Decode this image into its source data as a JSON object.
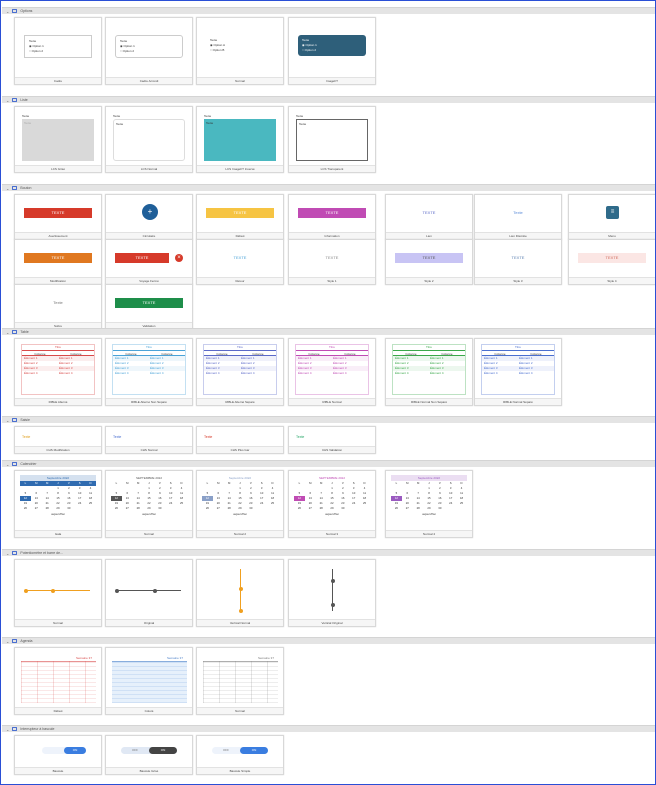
{
  "sections": [
    {
      "key": "radio",
      "title": "Options",
      "cards": [
        {
          "label": "Cadre",
          "title": "Texte",
          "options": [
            "Option 1",
            "Option 2"
          ]
        },
        {
          "label": "Cadre Arrondi",
          "title": "Texte",
          "options": [
            "Option 1",
            "Option 2"
          ]
        },
        {
          "label": "Normal",
          "title": "Texte",
          "options": [
            "Option A",
            "Option B"
          ]
        },
        {
          "label": "ImageFT",
          "title": "Texte",
          "options": [
            "Option 1",
            "Option 2"
          ]
        }
      ]
    },
    {
      "key": "list",
      "title": "Liste",
      "cards": [
        {
          "label": "LCS Grisé",
          "title": "Texte",
          "value": "Texte"
        },
        {
          "label": "LCS Normal",
          "title": "Texte",
          "value": "Texte"
        },
        {
          "label": "LCS ImageFT Inversé",
          "title": "Texte",
          "value": "Texte"
        },
        {
          "label": "LCS Transparent",
          "title": "Texte",
          "value": "Texte"
        }
      ]
    },
    {
      "key": "button",
      "title": "Bouton",
      "cards": [
        {
          "label": "Avertissement",
          "text": "TEXTE",
          "color": "#d63a2a"
        },
        {
          "label": "Circulaire",
          "text": "+",
          "color": "#1f5f99"
        },
        {
          "label": "Défaut",
          "text": "TEXTE",
          "color": "#f6c443"
        },
        {
          "label": "Information",
          "text": "TEXTE",
          "color": "#c04bb4"
        },
        {
          "label": "Lien",
          "text": "TEXTE",
          "color": "#5b69c8"
        },
        {
          "label": "Lien Discrète",
          "text": "Texte",
          "color": "#5b8bd8"
        },
        {
          "label": "Menu",
          "text": "≡",
          "color": "#2f6b8a"
        },
        {
          "label": "Modification",
          "text": "TEXTE",
          "color": "#e07820"
        },
        {
          "label": "Voyage Fermé",
          "text": "TEXTE",
          "color": "#d63a2a"
        },
        {
          "label": "Retour",
          "text": "TEXTE",
          "color": "#4aa3d8"
        },
        {
          "label": "Style 1",
          "text": "TEXTE",
          "color": "#888888"
        },
        {
          "label": "Style 2",
          "text": "TEXTE",
          "color": "#c8c4f4"
        },
        {
          "label": "Style 3",
          "text": "TEXTE",
          "color": "#9ab6d8"
        },
        {
          "label": "Style 4",
          "text": "TEXTE",
          "color": "#f5cac6"
        },
        {
          "label": "Sobre",
          "text": "Texte",
          "color": "#777777"
        },
        {
          "label": "Validation",
          "text": "TEXTE",
          "color": "#1e8e4a"
        }
      ]
    },
    {
      "key": "table",
      "title": "Table",
      "cards": [
        {
          "label": "RIBLE Alterné",
          "title": "Titre",
          "cols": [
            "Colonne",
            "Colonne"
          ],
          "rows": [
            "Élément 1",
            "Élément 2",
            "Élément 3",
            "Élément 4"
          ],
          "color": "#d84a4a"
        },
        {
          "label": "RIBLE Alterné Non Séparé",
          "title": "Titre",
          "cols": [
            "Colonne",
            "Colonne"
          ],
          "rows": [
            "Élément 1",
            "Élément 2",
            "Élément 3",
            "Élément 4"
          ],
          "color": "#4aa3d8"
        },
        {
          "label": "RIBLE Alterné Séparé",
          "title": "Titre",
          "cols": [
            "Colonne",
            "Colonne"
          ],
          "rows": [
            "Élément 1",
            "Élément 2",
            "Élément 3",
            "Élément 4"
          ],
          "color": "#5b69c8"
        },
        {
          "label": "RIBLE Normal",
          "title": "Titre",
          "cols": [
            "Colonne",
            "Colonne"
          ],
          "rows": [
            "Élément 1",
            "Élément 2",
            "Élément 3",
            "Élément 4"
          ],
          "color": "#c04bb4"
        },
        {
          "label": "RIBLE Normal Non Séparé",
          "title": "Titre",
          "cols": [
            "Colonne",
            "Colonne"
          ],
          "rows": [
            "Élément 1",
            "Élément 2",
            "Élément 3",
            "Élément 4"
          ],
          "color": "#3aa84a"
        },
        {
          "label": "RIBLE Normal Séparé",
          "title": "Titre",
          "cols": [
            "Colonne",
            "Colonne"
          ],
          "rows": [
            "Élément 1",
            "Élément 2",
            "Élément 3",
            "Élément 4"
          ],
          "color": "#4a6fd0"
        }
      ]
    },
    {
      "key": "text",
      "title": "Saisie",
      "cards": [
        {
          "label": "CHS Modification",
          "value": "Texte",
          "color": "#e0a020"
        },
        {
          "label": "CHS Normal",
          "value": "Texte",
          "color": "#4a6fd0"
        },
        {
          "label": "CHS Plus Gar",
          "value": "Texte",
          "color": "#d63a2a"
        },
        {
          "label": "CHS Validation",
          "value": "Texte",
          "color": "#2aa86a"
        }
      ]
    },
    {
      "key": "cal",
      "title": "Calendrier",
      "cards": [
        {
          "label": "Gala",
          "month": "Septembre 2022",
          "today": "aujourd'hui",
          "color": "#2f6bb0"
        },
        {
          "label": "Normal",
          "month": "SEPTEMBRE 2022",
          "today": "aujourd'hui",
          "color": "#555555"
        },
        {
          "label": "Normal 2",
          "month": "Septembre 2022",
          "today": "aujourd'hui",
          "color": "#8aa0c8"
        },
        {
          "label": "Normal 3",
          "month": "SEPTEMBRE 2022",
          "today": "aujourd'hui",
          "color": "#c04bb4"
        },
        {
          "label": "Normal 4",
          "month": "Septembre 2022",
          "today": "aujourd'hui",
          "color": "#9a5ac0"
        }
      ]
    },
    {
      "key": "range",
      "title": "Potentiomètre et barre de...",
      "cards": [
        {
          "label": "Normal",
          "color": "#f0a020"
        },
        {
          "label": "Original",
          "color": "#555555"
        },
        {
          "label": "Vertical Normal",
          "color": "#f0a020"
        },
        {
          "label": "Vertical Original",
          "color": "#555555"
        }
      ]
    },
    {
      "key": "agenda",
      "title": "Agenda",
      "cards": [
        {
          "label": "Défaut",
          "week": "Semaine 37",
          "color": "#d84a4a"
        },
        {
          "label": "Coloré",
          "week": "Semaine 37",
          "color": "#4a7fc8"
        },
        {
          "label": "Normal",
          "week": "Semaine 37",
          "color": "#777777"
        }
      ]
    },
    {
      "key": "toggle",
      "title": "Interrupteur à bascule",
      "cards": [
        {
          "label": "Bascule",
          "off": "",
          "on": "ON"
        },
        {
          "label": "Bascule Grisé",
          "off": "OFF",
          "on": "ON"
        },
        {
          "label": "Bascule Simple",
          "off": "OFF",
          "on": "ON"
        }
      ]
    }
  ]
}
